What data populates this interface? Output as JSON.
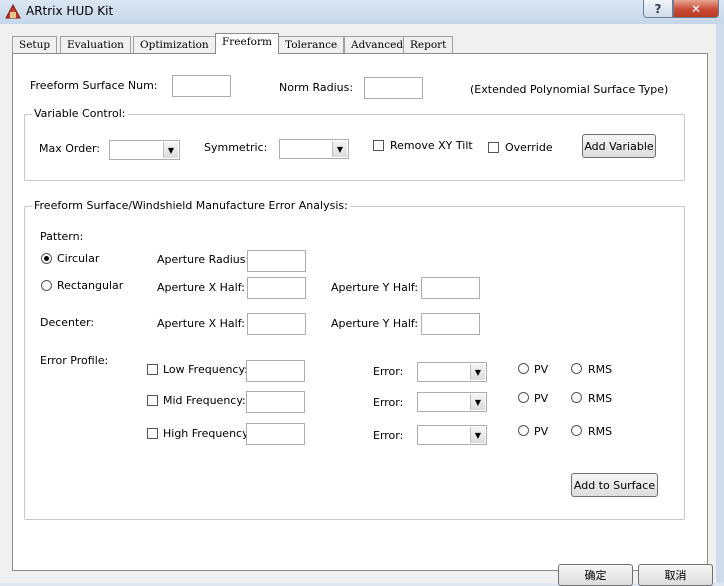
{
  "window": {
    "title": "ARtrix HUD Kit",
    "help_glyph": "?",
    "close_glyph": "✕"
  },
  "tabs": [
    "Setup",
    "Evaluation",
    "Optimization",
    "Freeform",
    "Tolerance",
    "Advanced",
    "Report"
  ],
  "active_tab": "Freeform",
  "top_row": {
    "surface_num_label": "Freeform Surface Num:",
    "surface_num_value": "",
    "norm_radius_label": "Norm Radius:",
    "norm_radius_value": "",
    "surface_type_note": "(Extended Polynomial Surface Type)"
  },
  "variable_control": {
    "legend": "Variable Control:",
    "max_order_label": "Max Order:",
    "max_order_value": "",
    "symmetric_label": "Symmetric:",
    "symmetric_value": "",
    "remove_tilt_label": "Remove XY Tilt",
    "remove_tilt_checked": false,
    "override_label": "Override",
    "override_checked": false,
    "add_variable_button": "Add Variable"
  },
  "error_analysis": {
    "legend": "Freeform Surface/Windshield Manufacture Error Analysis:",
    "pattern_label": "Pattern:",
    "circular_label": "Circular",
    "rectangular_label": "Rectangular",
    "pattern_selected": "Circular",
    "aperture_radius_label": "Aperture Radius:",
    "aperture_x_half_label": "Aperture X Half:",
    "aperture_y_half_label": "Aperture Y Half:",
    "decenter_label": "Decenter:",
    "decenter_x_label": "Aperture X Half:",
    "decenter_y_label": "Aperture Y Half:",
    "error_profile_label": "Error Profile:",
    "rows": [
      {
        "label": "Low Frequency:",
        "error_label": "Error:",
        "pv": "PV",
        "rms": "RMS"
      },
      {
        "label": "Mid Frequency:",
        "error_label": "Error:",
        "pv": "PV",
        "rms": "RMS"
      },
      {
        "label": "High Frequency:",
        "error_label": "Error:",
        "pv": "PV",
        "rms": "RMS"
      }
    ],
    "add_to_surface_button": "Add to Surface"
  },
  "footer": {
    "ok_button": "确定",
    "cancel_button": "取消"
  }
}
